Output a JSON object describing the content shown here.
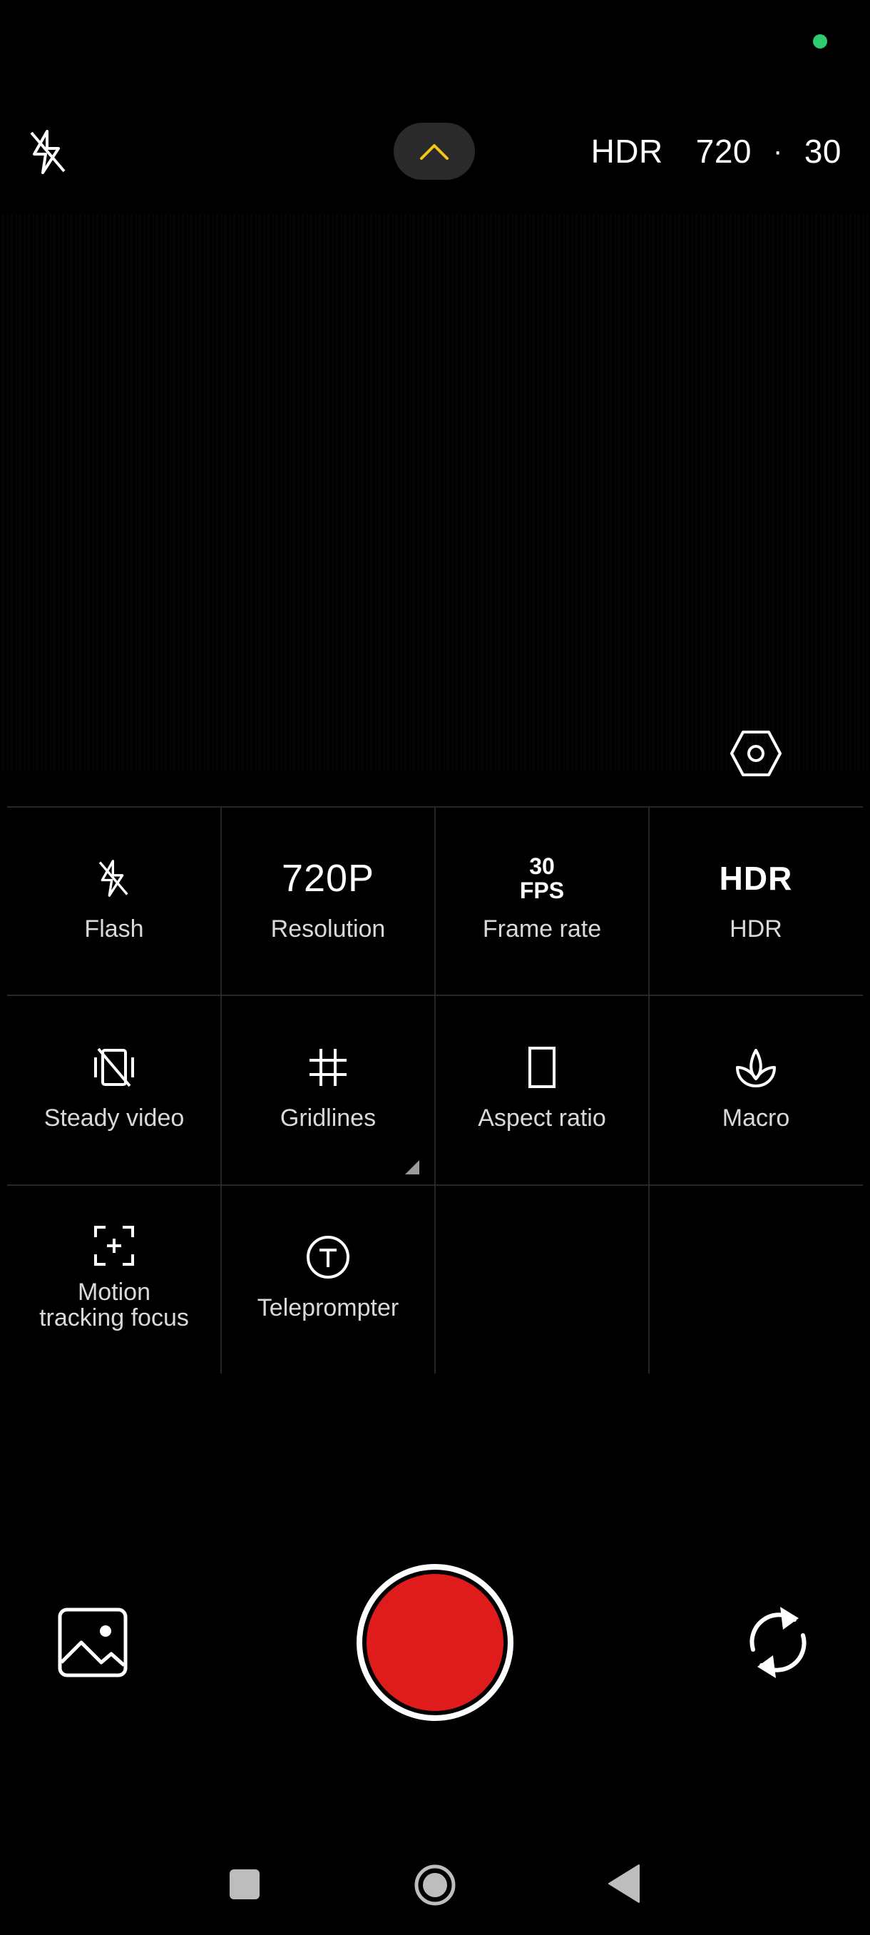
{
  "top_bar": {
    "hdr_label": "HDR",
    "resolution_value": "720",
    "separator": "·",
    "fps_value": "30"
  },
  "quick_settings": [
    {
      "id": "flash",
      "label": "Flash",
      "icon": "flash-off-icon"
    },
    {
      "id": "resolution",
      "label": "Resolution",
      "value": "720P"
    },
    {
      "id": "frame-rate",
      "label": "Frame rate",
      "value_top": "30",
      "value_bottom": "FPS"
    },
    {
      "id": "hdr",
      "label": "HDR",
      "value": "HDR"
    },
    {
      "id": "steady-video",
      "label": "Steady video",
      "icon": "steady-video-off-icon"
    },
    {
      "id": "gridlines",
      "label": "Gridlines",
      "icon": "grid-icon"
    },
    {
      "id": "aspect-ratio",
      "label": "Aspect ratio",
      "icon": "aspect-ratio-icon"
    },
    {
      "id": "macro",
      "label": "Macro",
      "icon": "macro-flower-icon"
    },
    {
      "id": "motion-tracking-focus",
      "label_line1": "Motion",
      "label_line2": "tracking focus",
      "icon": "focus-frame-icon"
    },
    {
      "id": "teleprompter",
      "label": "Teleprompter",
      "icon": "teleprompter-icon"
    }
  ],
  "colors": {
    "background": "#000000",
    "accent_chevron": "#f5c518",
    "record_button": "#e01b1b",
    "status_dot": "#2ecc71"
  }
}
